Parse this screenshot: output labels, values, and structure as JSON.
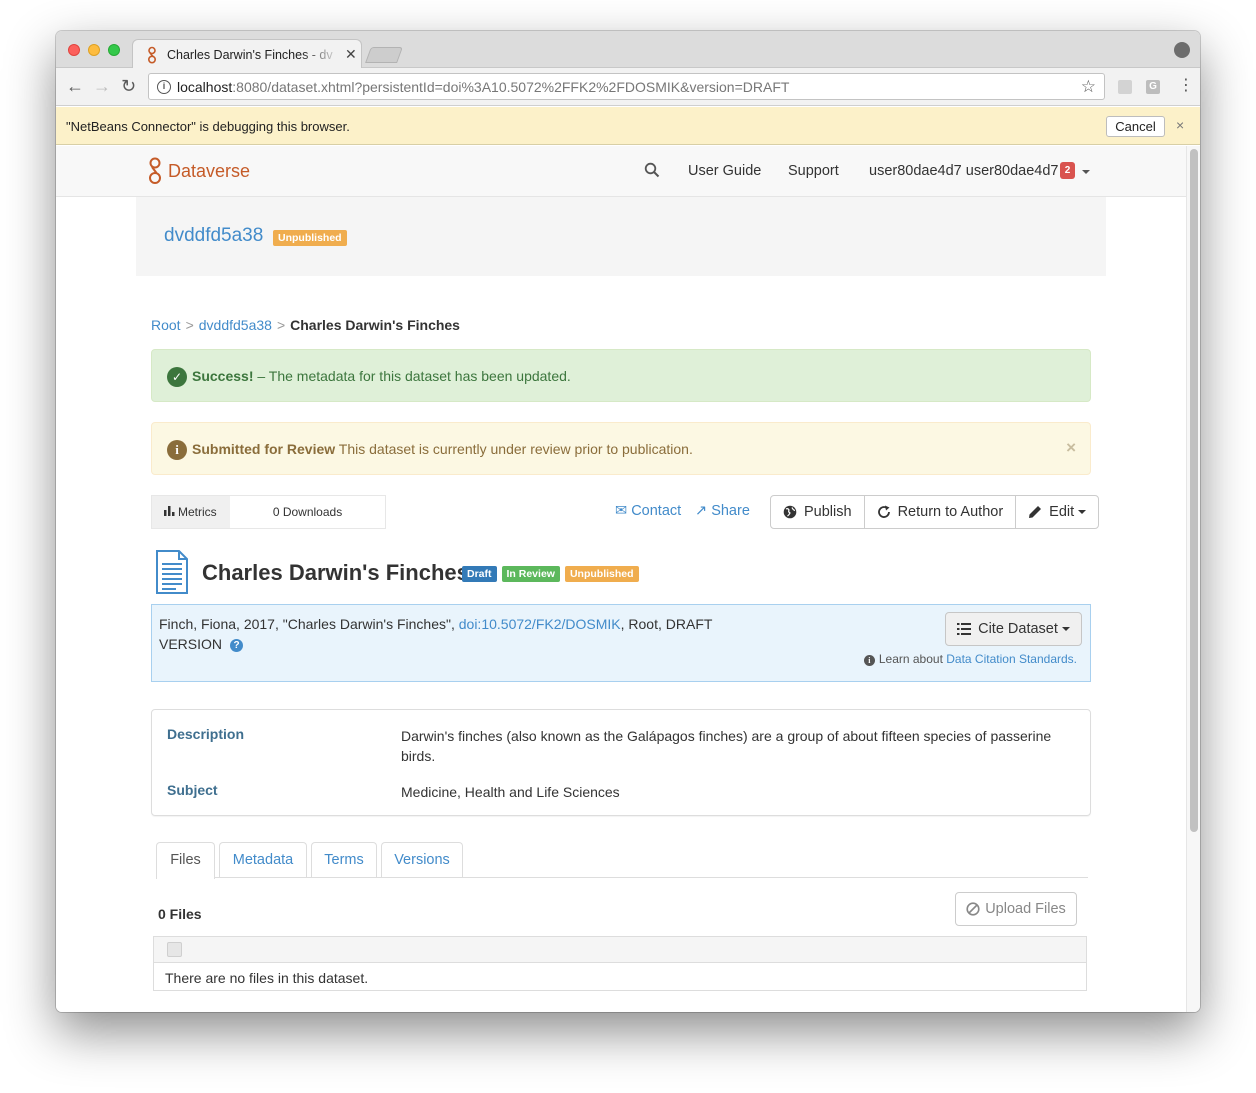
{
  "browser": {
    "tab_title": "Charles Darwin's Finches - dv",
    "tab_close": "✕",
    "url_host": "localhost",
    "url_path": ":8080/dataset.xhtml?persistentId=doi%3A10.5072%2FFK2%2FDOSMIK&version=DRAFT",
    "ext_label": "G"
  },
  "infobar": {
    "message": "\"NetBeans Connector\" is debugging this browser.",
    "cancel_label": "Cancel",
    "close": "×"
  },
  "navbar": {
    "brand": "Dataverse",
    "user_guide": "User Guide",
    "support": "Support",
    "user": "user80dae4d7 user80dae4d7",
    "notification_count": "2"
  },
  "dataverse": {
    "name": "dvddfd5a38",
    "badge": "Unpublished"
  },
  "breadcrumb": {
    "root": "Root",
    "sep": ">",
    "dataverse": "dvddfd5a38",
    "current": "Charles Darwin's Finches"
  },
  "alerts": {
    "success_title": "Success!",
    "success_text": " – The metadata for this dataset has been updated.",
    "review_title": "Submitted for Review",
    "review_text": " This dataset is currently under review prior to publication.",
    "close": "×"
  },
  "metrics": {
    "label": "Metrics",
    "downloads": "0 Downloads"
  },
  "actions": {
    "contact": "Contact",
    "share": "Share",
    "publish": "Publish",
    "return_to_author": "Return to Author",
    "edit": "Edit"
  },
  "dataset": {
    "title": "Charles Darwin's Finches",
    "labels": {
      "draft": "Draft",
      "in_review": "In Review",
      "unpublished": "Unpublished"
    }
  },
  "citation": {
    "text_before": "Finch, Fiona, 2017, \"Charles Darwin's Finches\", ",
    "doi": "doi:10.5072/FK2/DOSMIK",
    "text_after": ", Root, DRAFT VERSION",
    "help_icon": "?",
    "cite_button": "Cite Dataset",
    "learn_prefix": "Learn about ",
    "learn_link": "Data Citation Standards."
  },
  "summary": {
    "description_label": "Description",
    "description_value": "Darwin's finches (also known as the Galápagos finches) are a group of about fifteen species of passerine birds.",
    "subject_label": "Subject",
    "subject_value": "Medicine, Health and Life Sciences"
  },
  "tabs": {
    "files": "Files",
    "metadata": "Metadata",
    "terms": "Terms",
    "versions": "Versions"
  },
  "files": {
    "count": "0 Files",
    "upload_button": "Upload Files",
    "empty_message": "There are no files in this dataset."
  },
  "colors": {
    "brand": "#c55b28",
    "link": "#428bca",
    "success_bg": "#dff0d8",
    "warning_bg": "#fcf8e3",
    "label_orange": "#f0ad4e",
    "label_blue": "#337ab7",
    "label_green": "#5cb85c",
    "badge_red": "#d9534f"
  },
  "icons": {
    "logo": "dataverse-logo-icon",
    "search": "search-icon",
    "metrics": "bar-chart-icon",
    "contact": "envelope-icon",
    "share": "share-icon",
    "publish": "globe-icon",
    "return": "refresh-icon",
    "edit": "pencil-icon",
    "dataset": "document-icon",
    "cite": "list-icon",
    "upload": "ban-icon"
  }
}
